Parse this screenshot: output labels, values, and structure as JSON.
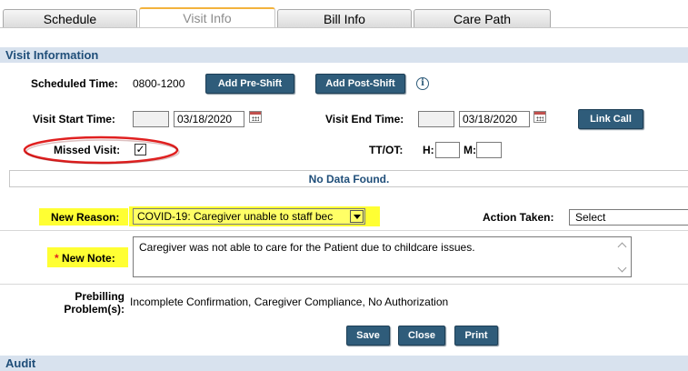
{
  "tabs": [
    {
      "label": "Schedule"
    },
    {
      "label": "Visit Info"
    },
    {
      "label": "Bill Info"
    },
    {
      "label": "Care Path"
    }
  ],
  "sections": {
    "visit_info": "Visit Information",
    "audit": "Audit"
  },
  "scheduled": {
    "label": "Scheduled Time:",
    "value": "0800-1200",
    "add_pre_shift": "Add Pre-Shift",
    "add_post_shift": "Add Post-Shift",
    "info_icon": "i"
  },
  "visit_start": {
    "label": "Visit Start Time:",
    "time": "",
    "date": "03/18/2020"
  },
  "visit_end": {
    "label": "Visit End Time:",
    "time": "",
    "date": "03/18/2020"
  },
  "link_call": "Link Call",
  "missed_visit": {
    "label": "Missed Visit:",
    "checked_glyph": "✓"
  },
  "ttot": {
    "label": "TT/OT:",
    "h_label": "H:",
    "m_label": "M:"
  },
  "no_data": "No Data Found.",
  "new_reason": {
    "label": "New Reason:",
    "value": "COVID-19: Caregiver unable to staff bec"
  },
  "action_taken": {
    "label": "Action Taken:",
    "value": "Select"
  },
  "new_note": {
    "required_marker": "*",
    "label": "New Note:",
    "value": "Caregiver was not able to care for the Patient due to childcare issues."
  },
  "prebilling": {
    "label_line1": "Prebilling",
    "label_line2": "Problem(s):",
    "value": "Incomplete Confirmation, Caregiver Compliance, No Authorization"
  },
  "actions": {
    "save": "Save",
    "close": "Close",
    "print": "Print"
  },
  "colors": {
    "button_bg": "#2f5c7a",
    "section_bg": "#d8e2ee",
    "highlight": "#ffff33",
    "annotation_red": "#e02020"
  }
}
